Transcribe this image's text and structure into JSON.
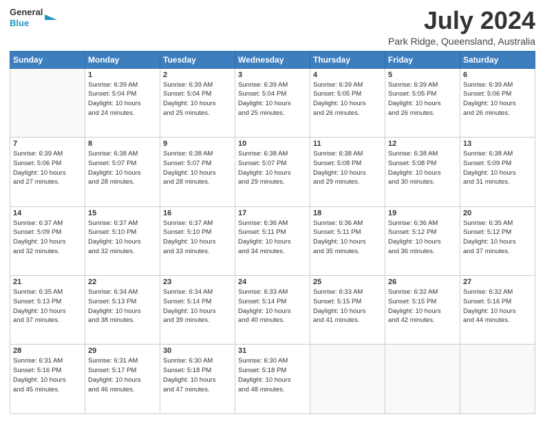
{
  "header": {
    "logo_line1": "General",
    "logo_line2": "Blue",
    "month_year": "July 2024",
    "location": "Park Ridge, Queensland, Australia"
  },
  "weekdays": [
    "Sunday",
    "Monday",
    "Tuesday",
    "Wednesday",
    "Thursday",
    "Friday",
    "Saturday"
  ],
  "weeks": [
    [
      {
        "day": "",
        "info": ""
      },
      {
        "day": "1",
        "info": "Sunrise: 6:39 AM\nSunset: 5:04 PM\nDaylight: 10 hours\nand 24 minutes."
      },
      {
        "day": "2",
        "info": "Sunrise: 6:39 AM\nSunset: 5:04 PM\nDaylight: 10 hours\nand 25 minutes."
      },
      {
        "day": "3",
        "info": "Sunrise: 6:39 AM\nSunset: 5:04 PM\nDaylight: 10 hours\nand 25 minutes."
      },
      {
        "day": "4",
        "info": "Sunrise: 6:39 AM\nSunset: 5:05 PM\nDaylight: 10 hours\nand 26 minutes."
      },
      {
        "day": "5",
        "info": "Sunrise: 6:39 AM\nSunset: 5:05 PM\nDaylight: 10 hours\nand 26 minutes."
      },
      {
        "day": "6",
        "info": "Sunrise: 6:39 AM\nSunset: 5:06 PM\nDaylight: 10 hours\nand 26 minutes."
      }
    ],
    [
      {
        "day": "7",
        "info": "Sunrise: 6:39 AM\nSunset: 5:06 PM\nDaylight: 10 hours\nand 27 minutes."
      },
      {
        "day": "8",
        "info": "Sunrise: 6:38 AM\nSunset: 5:07 PM\nDaylight: 10 hours\nand 28 minutes."
      },
      {
        "day": "9",
        "info": "Sunrise: 6:38 AM\nSunset: 5:07 PM\nDaylight: 10 hours\nand 28 minutes."
      },
      {
        "day": "10",
        "info": "Sunrise: 6:38 AM\nSunset: 5:07 PM\nDaylight: 10 hours\nand 29 minutes."
      },
      {
        "day": "11",
        "info": "Sunrise: 6:38 AM\nSunset: 5:08 PM\nDaylight: 10 hours\nand 29 minutes."
      },
      {
        "day": "12",
        "info": "Sunrise: 6:38 AM\nSunset: 5:08 PM\nDaylight: 10 hours\nand 30 minutes."
      },
      {
        "day": "13",
        "info": "Sunrise: 6:38 AM\nSunset: 5:09 PM\nDaylight: 10 hours\nand 31 minutes."
      }
    ],
    [
      {
        "day": "14",
        "info": "Sunrise: 6:37 AM\nSunset: 5:09 PM\nDaylight: 10 hours\nand 32 minutes."
      },
      {
        "day": "15",
        "info": "Sunrise: 6:37 AM\nSunset: 5:10 PM\nDaylight: 10 hours\nand 32 minutes."
      },
      {
        "day": "16",
        "info": "Sunrise: 6:37 AM\nSunset: 5:10 PM\nDaylight: 10 hours\nand 33 minutes."
      },
      {
        "day": "17",
        "info": "Sunrise: 6:36 AM\nSunset: 5:11 PM\nDaylight: 10 hours\nand 34 minutes."
      },
      {
        "day": "18",
        "info": "Sunrise: 6:36 AM\nSunset: 5:11 PM\nDaylight: 10 hours\nand 35 minutes."
      },
      {
        "day": "19",
        "info": "Sunrise: 6:36 AM\nSunset: 5:12 PM\nDaylight: 10 hours\nand 36 minutes."
      },
      {
        "day": "20",
        "info": "Sunrise: 6:35 AM\nSunset: 5:12 PM\nDaylight: 10 hours\nand 37 minutes."
      }
    ],
    [
      {
        "day": "21",
        "info": "Sunrise: 6:35 AM\nSunset: 5:13 PM\nDaylight: 10 hours\nand 37 minutes."
      },
      {
        "day": "22",
        "info": "Sunrise: 6:34 AM\nSunset: 5:13 PM\nDaylight: 10 hours\nand 38 minutes."
      },
      {
        "day": "23",
        "info": "Sunrise: 6:34 AM\nSunset: 5:14 PM\nDaylight: 10 hours\nand 39 minutes."
      },
      {
        "day": "24",
        "info": "Sunrise: 6:33 AM\nSunset: 5:14 PM\nDaylight: 10 hours\nand 40 minutes."
      },
      {
        "day": "25",
        "info": "Sunrise: 6:33 AM\nSunset: 5:15 PM\nDaylight: 10 hours\nand 41 minutes."
      },
      {
        "day": "26",
        "info": "Sunrise: 6:32 AM\nSunset: 5:15 PM\nDaylight: 10 hours\nand 42 minutes."
      },
      {
        "day": "27",
        "info": "Sunrise: 6:32 AM\nSunset: 5:16 PM\nDaylight: 10 hours\nand 44 minutes."
      }
    ],
    [
      {
        "day": "28",
        "info": "Sunrise: 6:31 AM\nSunset: 5:16 PM\nDaylight: 10 hours\nand 45 minutes."
      },
      {
        "day": "29",
        "info": "Sunrise: 6:31 AM\nSunset: 5:17 PM\nDaylight: 10 hours\nand 46 minutes."
      },
      {
        "day": "30",
        "info": "Sunrise: 6:30 AM\nSunset: 5:18 PM\nDaylight: 10 hours\nand 47 minutes."
      },
      {
        "day": "31",
        "info": "Sunrise: 6:30 AM\nSunset: 5:18 PM\nDaylight: 10 hours\nand 48 minutes."
      },
      {
        "day": "",
        "info": ""
      },
      {
        "day": "",
        "info": ""
      },
      {
        "day": "",
        "info": ""
      }
    ]
  ]
}
